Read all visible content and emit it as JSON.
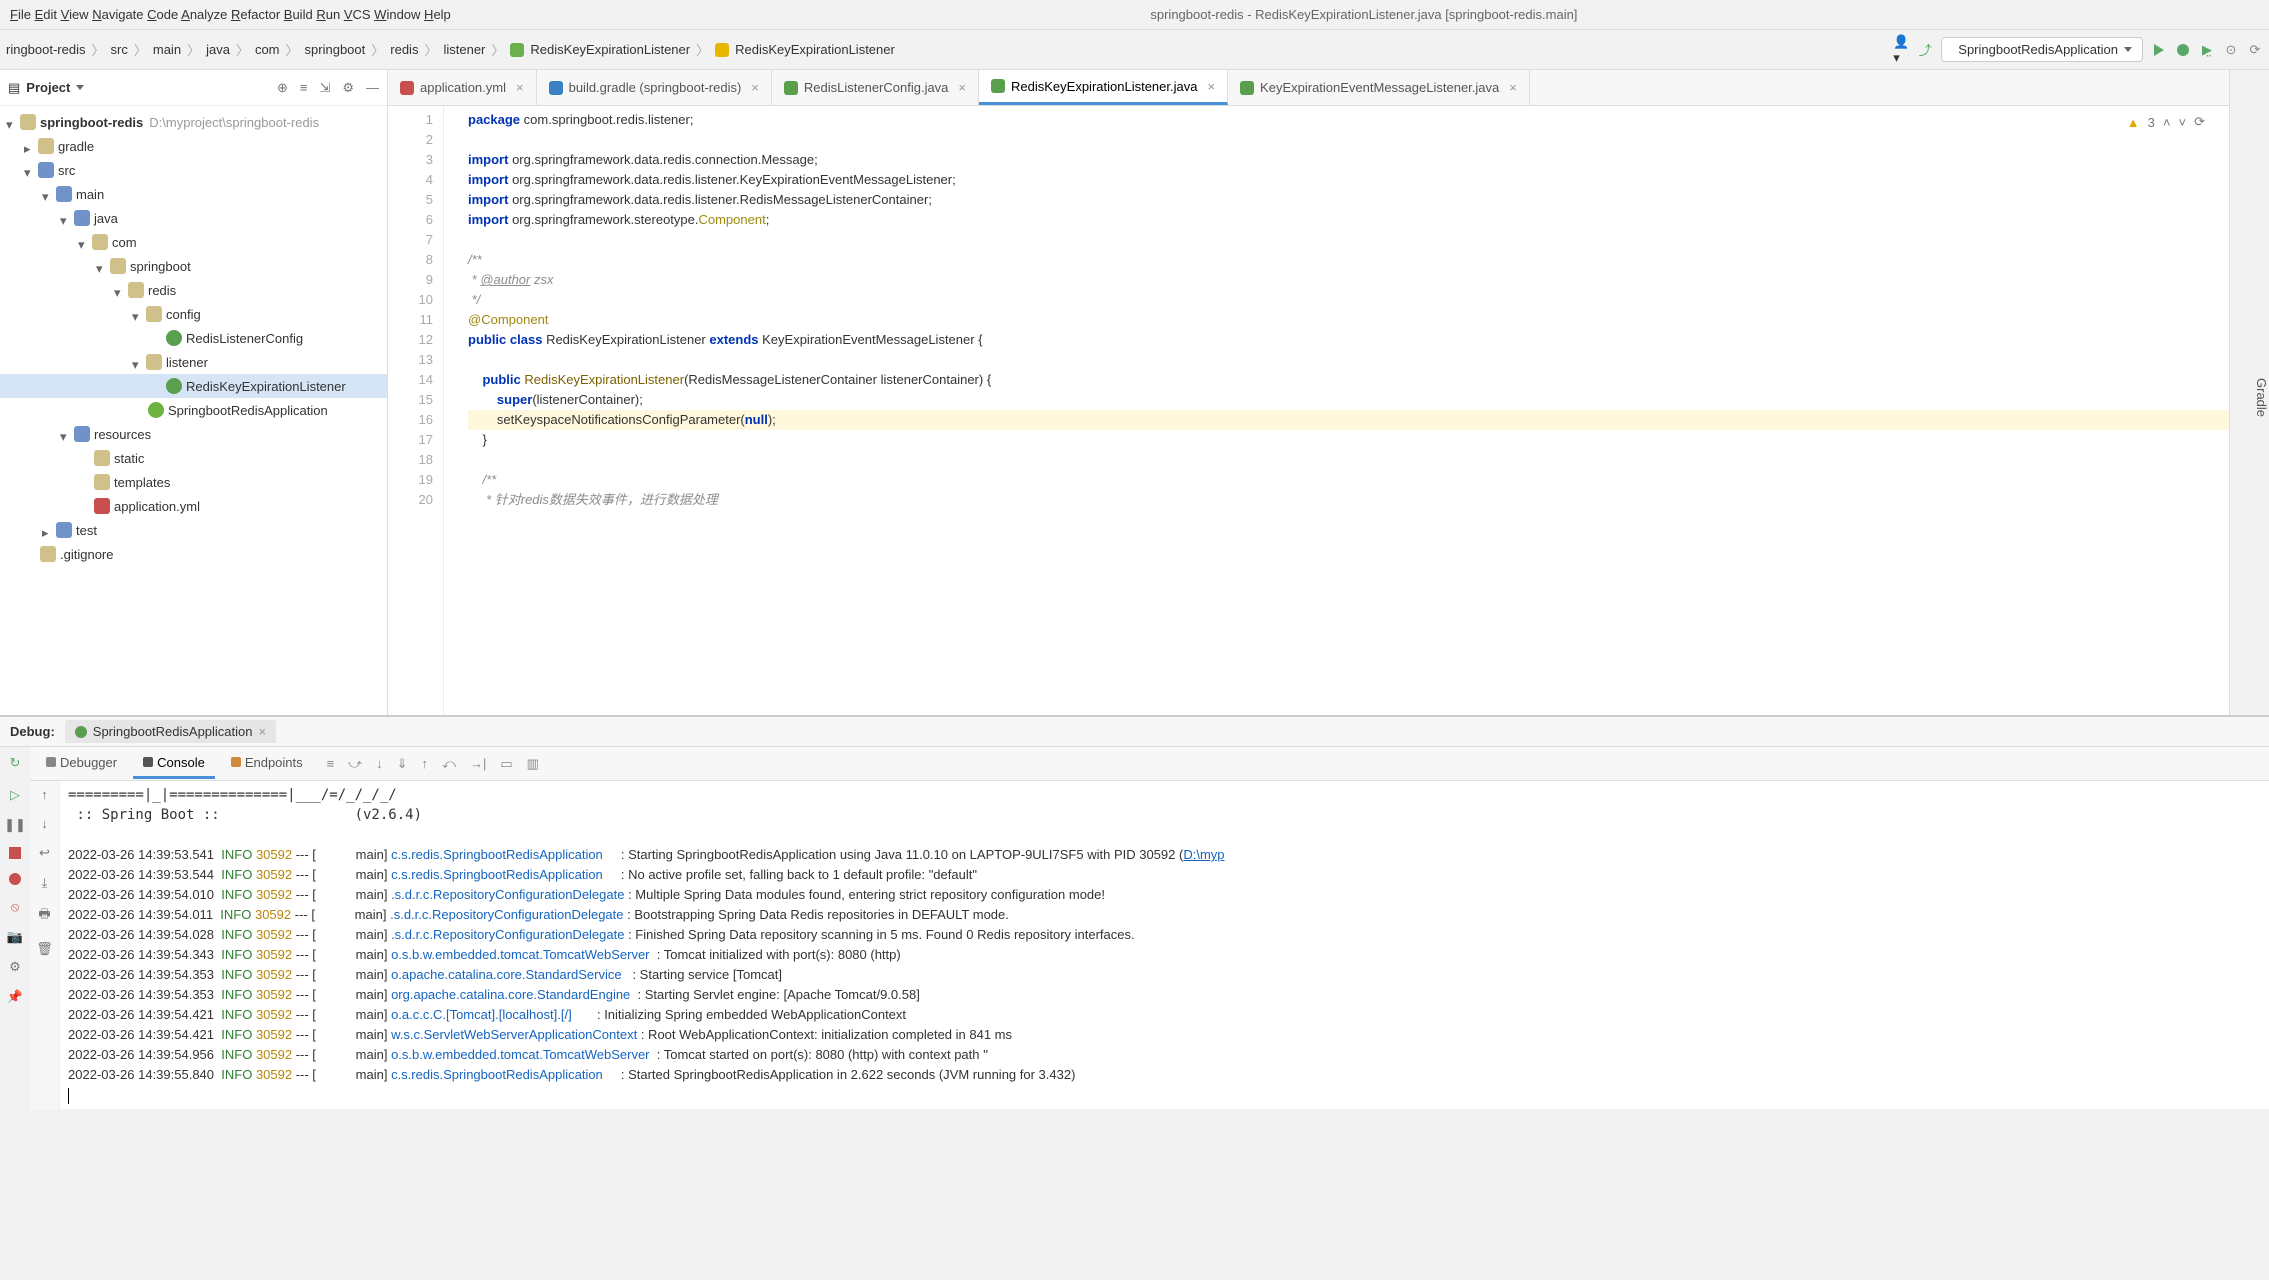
{
  "menu": {
    "items": [
      "File",
      "Edit",
      "View",
      "Navigate",
      "Code",
      "Analyze",
      "Refactor",
      "Build",
      "Run",
      "VCS",
      "Window",
      "Help"
    ],
    "title": "springboot-redis - RedisKeyExpirationListener.java [springboot-redis.main]"
  },
  "breadcrumb": {
    "parts": [
      "ringboot-redis",
      "src",
      "main",
      "java",
      "com",
      "springboot",
      "redis",
      "listener",
      "RedisKeyExpirationListener",
      "RedisKeyExpirationListener"
    ]
  },
  "run": {
    "config": "SpringbootRedisApplication"
  },
  "project": {
    "label": "Project",
    "root": {
      "name": "springboot-redis",
      "path": "D:\\myproject\\springboot-redis"
    },
    "nodes": [
      {
        "indent": 1,
        "open": false,
        "icon": "dir",
        "label": "gradle"
      },
      {
        "indent": 1,
        "open": true,
        "icon": "dirb",
        "label": "src"
      },
      {
        "indent": 2,
        "open": true,
        "icon": "dirb",
        "label": "main"
      },
      {
        "indent": 3,
        "open": true,
        "icon": "dirb",
        "label": "java"
      },
      {
        "indent": 4,
        "open": true,
        "icon": "dir",
        "label": "com"
      },
      {
        "indent": 5,
        "open": true,
        "icon": "dir",
        "label": "springboot"
      },
      {
        "indent": 6,
        "open": true,
        "icon": "dir",
        "label": "redis"
      },
      {
        "indent": 7,
        "open": true,
        "icon": "dir",
        "label": "config"
      },
      {
        "indent": 8,
        "leaf": true,
        "icon": "cls",
        "label": "RedisListenerConfig"
      },
      {
        "indent": 7,
        "open": true,
        "icon": "dir",
        "label": "listener"
      },
      {
        "indent": 8,
        "leaf": true,
        "icon": "cls",
        "label": "RedisKeyExpirationListener",
        "sel": true
      },
      {
        "indent": 7,
        "leaf": true,
        "icon": "sb",
        "label": "SpringbootRedisApplication"
      },
      {
        "indent": 3,
        "open": true,
        "icon": "dirb",
        "label": "resources"
      },
      {
        "indent": 4,
        "leaf": true,
        "icon": "dir",
        "label": "static"
      },
      {
        "indent": 4,
        "leaf": true,
        "icon": "dir",
        "label": "templates"
      },
      {
        "indent": 4,
        "leaf": true,
        "icon": "yml",
        "label": "application.yml"
      },
      {
        "indent": 2,
        "open": false,
        "icon": "dirb",
        "label": "test"
      },
      {
        "indent": 1,
        "leaf": true,
        "icon": "dir",
        "label": ".gitignore"
      }
    ]
  },
  "tabs": [
    {
      "icon": "ic-yml",
      "label": "application.yml"
    },
    {
      "icon": "ic-gr",
      "label": "build.gradle (springboot-redis)"
    },
    {
      "icon": "ic-j",
      "label": "RedisListenerConfig.java"
    },
    {
      "icon": "ic-j",
      "label": "RedisKeyExpirationListener.java",
      "active": true
    },
    {
      "icon": "ic-j",
      "label": "KeyExpirationEventMessageListener.java"
    }
  ],
  "gradle_label": "Gradle",
  "inspection": {
    "warn_count": "3"
  },
  "code": {
    "lines": [
      {
        "n": 1,
        "html": "<span class='kw'>package</span> com.springboot.redis.listener;"
      },
      {
        "n": 2,
        "html": ""
      },
      {
        "n": 3,
        "html": "<span class='kw'>import</span> org.springframework.data.redis.connection.Message;"
      },
      {
        "n": 4,
        "html": "<span class='kw'>import</span> org.springframework.data.redis.listener.KeyExpirationEventMessageListener;"
      },
      {
        "n": 5,
        "html": "<span class='kw'>import</span> org.springframework.data.redis.listener.RedisMessageListenerContainer;"
      },
      {
        "n": 6,
        "html": "<span class='kw'>import</span> org.springframework.stereotype.<span class='ann'>Component</span>;"
      },
      {
        "n": 7,
        "html": ""
      },
      {
        "n": 8,
        "html": "<span class='cmt'>/**</span>"
      },
      {
        "n": 9,
        "html": "<span class='cmt'> * <span class='tag'>@author</span> zsx</span>"
      },
      {
        "n": 10,
        "html": "<span class='cmt'> */</span>"
      },
      {
        "n": 11,
        "html": "<span class='ann'>@Component</span>"
      },
      {
        "n": 12,
        "html": "<span class='kw'>public</span> <span class='kw'>class</span> RedisKeyExpirationListener <span class='kw'>extends</span> KeyExpirationEventMessageListener {"
      },
      {
        "n": 13,
        "html": ""
      },
      {
        "n": 14,
        "html": "    <span class='kw'>public</span> <span class='fn'>RedisKeyExpirationListener</span>(RedisMessageListenerContainer listenerContainer) {"
      },
      {
        "n": 15,
        "html": "        <span class='kw'>super</span>(listenerContainer);"
      },
      {
        "n": 16,
        "hl": true,
        "html": "        setKeyspaceNotificationsConfigParameter(<span class='kw'>null</span>);"
      },
      {
        "n": 17,
        "html": "    }"
      },
      {
        "n": 18,
        "html": ""
      },
      {
        "n": 19,
        "html": "    <span class='cmt'>/**</span>"
      },
      {
        "n": 20,
        "html": "    <span class='cmt'> * 针对redis数据失效事件，进行数据处理</span>"
      }
    ]
  },
  "debug": {
    "label": "Debug:",
    "app": "SpringbootRedisApplication",
    "tabs": [
      "Debugger",
      "Console",
      "Endpoints"
    ],
    "banner": "=========|_|==============|___/=/_/_/_/\n :: Spring Boot ::                (v2.6.4)",
    "logs": [
      {
        "ts": "2022-03-26 14:39:53.541",
        "lvl": "INFO",
        "pid": "30592",
        "th": "main",
        "lg": "c.s.redis.SpringbootRedisApplication",
        "msg": "Starting SpringbootRedisApplication using Java 11.0.10 on LAPTOP-9ULI7SF5 with PID 30592 (",
        "link": "D:\\myp"
      },
      {
        "ts": "2022-03-26 14:39:53.544",
        "lvl": "INFO",
        "pid": "30592",
        "th": "main",
        "lg": "c.s.redis.SpringbootRedisApplication",
        "msg": "No active profile set, falling back to 1 default profile: \"default\""
      },
      {
        "ts": "2022-03-26 14:39:54.010",
        "lvl": "INFO",
        "pid": "30592",
        "th": "main",
        "lg": ".s.d.r.c.RepositoryConfigurationDelegate",
        "msg": "Multiple Spring Data modules found, entering strict repository configuration mode!"
      },
      {
        "ts": "2022-03-26 14:39:54.011",
        "lvl": "INFO",
        "pid": "30592",
        "th": "main",
        "lg": ".s.d.r.c.RepositoryConfigurationDelegate",
        "msg": "Bootstrapping Spring Data Redis repositories in DEFAULT mode."
      },
      {
        "ts": "2022-03-26 14:39:54.028",
        "lvl": "INFO",
        "pid": "30592",
        "th": "main",
        "lg": ".s.d.r.c.RepositoryConfigurationDelegate",
        "msg": "Finished Spring Data repository scanning in 5 ms. Found 0 Redis repository interfaces."
      },
      {
        "ts": "2022-03-26 14:39:54.343",
        "lvl": "INFO",
        "pid": "30592",
        "th": "main",
        "lg": "o.s.b.w.embedded.tomcat.TomcatWebServer",
        "msg": "Tomcat initialized with port(s): 8080 (http)"
      },
      {
        "ts": "2022-03-26 14:39:54.353",
        "lvl": "INFO",
        "pid": "30592",
        "th": "main",
        "lg": "o.apache.catalina.core.StandardService",
        "msg": "Starting service [Tomcat]"
      },
      {
        "ts": "2022-03-26 14:39:54.353",
        "lvl": "INFO",
        "pid": "30592",
        "th": "main",
        "lg": "org.apache.catalina.core.StandardEngine",
        "msg": "Starting Servlet engine: [Apache Tomcat/9.0.58]"
      },
      {
        "ts": "2022-03-26 14:39:54.421",
        "lvl": "INFO",
        "pid": "30592",
        "th": "main",
        "lg": "o.a.c.c.C.[Tomcat].[localhost].[/]",
        "msg": "Initializing Spring embedded WebApplicationContext"
      },
      {
        "ts": "2022-03-26 14:39:54.421",
        "lvl": "INFO",
        "pid": "30592",
        "th": "main",
        "lg": "w.s.c.ServletWebServerApplicationContext",
        "msg": "Root WebApplicationContext: initialization completed in 841 ms"
      },
      {
        "ts": "2022-03-26 14:39:54.956",
        "lvl": "INFO",
        "pid": "30592",
        "th": "main",
        "lg": "o.s.b.w.embedded.tomcat.TomcatWebServer",
        "msg": "Tomcat started on port(s): 8080 (http) with context path ''"
      },
      {
        "ts": "2022-03-26 14:39:55.840",
        "lvl": "INFO",
        "pid": "30592",
        "th": "main",
        "lg": "c.s.redis.SpringbootRedisApplication",
        "msg": "Started SpringbootRedisApplication in 2.622 seconds (JVM running for 3.432)"
      }
    ]
  }
}
